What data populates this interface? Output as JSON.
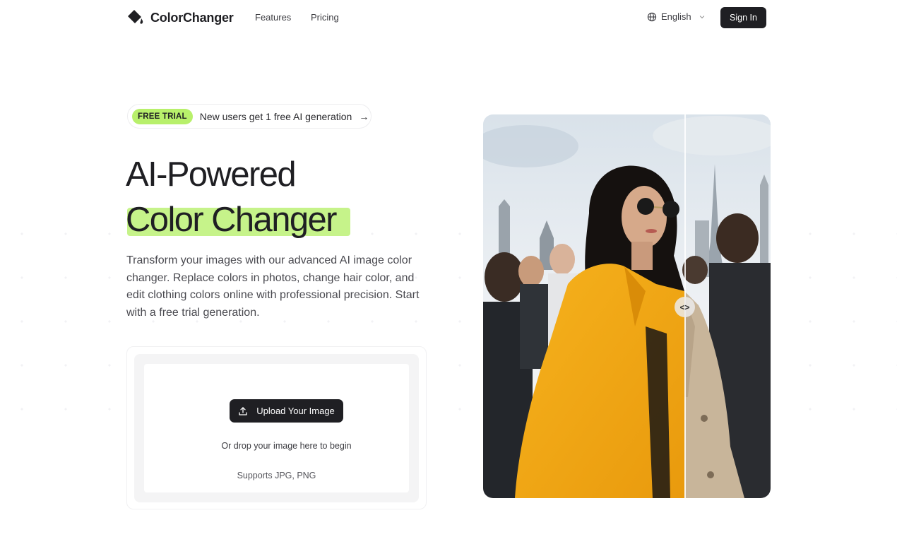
{
  "header": {
    "brand": "ColorChanger",
    "nav": [
      {
        "label": "Features"
      },
      {
        "label": "Pricing"
      }
    ],
    "language": "English",
    "signin_label": "Sign In"
  },
  "hero": {
    "badge": "FREE TRIAL",
    "trial_text": "New users get 1 free AI generation",
    "arrow": "→",
    "title_line1": "AI-Powered",
    "title_line2": "Color Changer",
    "description": "Transform your images with our advanced AI image color changer. Replace colors in photos, change hair color, and edit clothing colors online with professional precision. Start with a free trial generation."
  },
  "upload": {
    "button_label": "Upload Your Image",
    "drop_text": "Or drop your image here to begin",
    "supports": "Supports JPG, PNG"
  },
  "compare": {
    "handle_icon": "<>"
  },
  "colors": {
    "accent": "#b8f06b",
    "highlight": "#c6f38a",
    "dark": "#1f1f23",
    "coat_yellow": "#f2a814",
    "coat_beige": "#c8b59a"
  },
  "icons": [
    "logo-bucket-icon",
    "globe-icon",
    "chevron-down-icon",
    "arrow-right-icon",
    "upload-icon",
    "compare-handle-icon"
  ]
}
